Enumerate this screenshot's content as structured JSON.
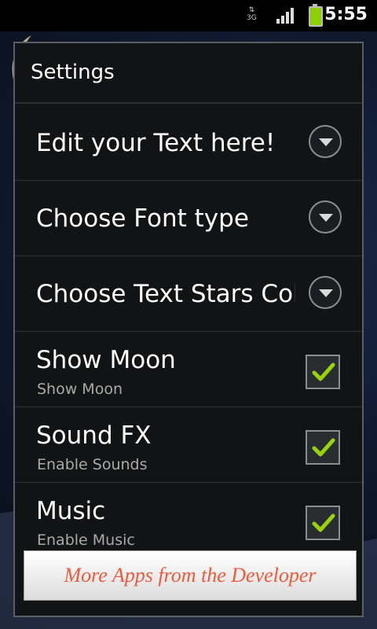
{
  "status_bar": {
    "network": "3G",
    "time": "5:55"
  },
  "dialog": {
    "title": "Settings",
    "items": [
      {
        "title": "Edit your Text here!",
        "control": "dropdown"
      },
      {
        "title": "Choose Font type",
        "control": "dropdown"
      },
      {
        "title": "Choose Text Stars Colo",
        "control": "dropdown"
      },
      {
        "title": "Show Moon",
        "subtitle": "Show Moon",
        "control": "checkbox",
        "checked": true
      },
      {
        "title": "Sound FX",
        "subtitle": "Enable Sounds",
        "control": "checkbox",
        "checked": true
      },
      {
        "title": "Music",
        "subtitle": "Enable Music",
        "control": "checkbox",
        "checked": true
      }
    ],
    "more_apps_label": "More Apps from the Developer"
  },
  "colors": {
    "check": "#9ad30a",
    "more_apps_text": "#ee5a3c"
  }
}
